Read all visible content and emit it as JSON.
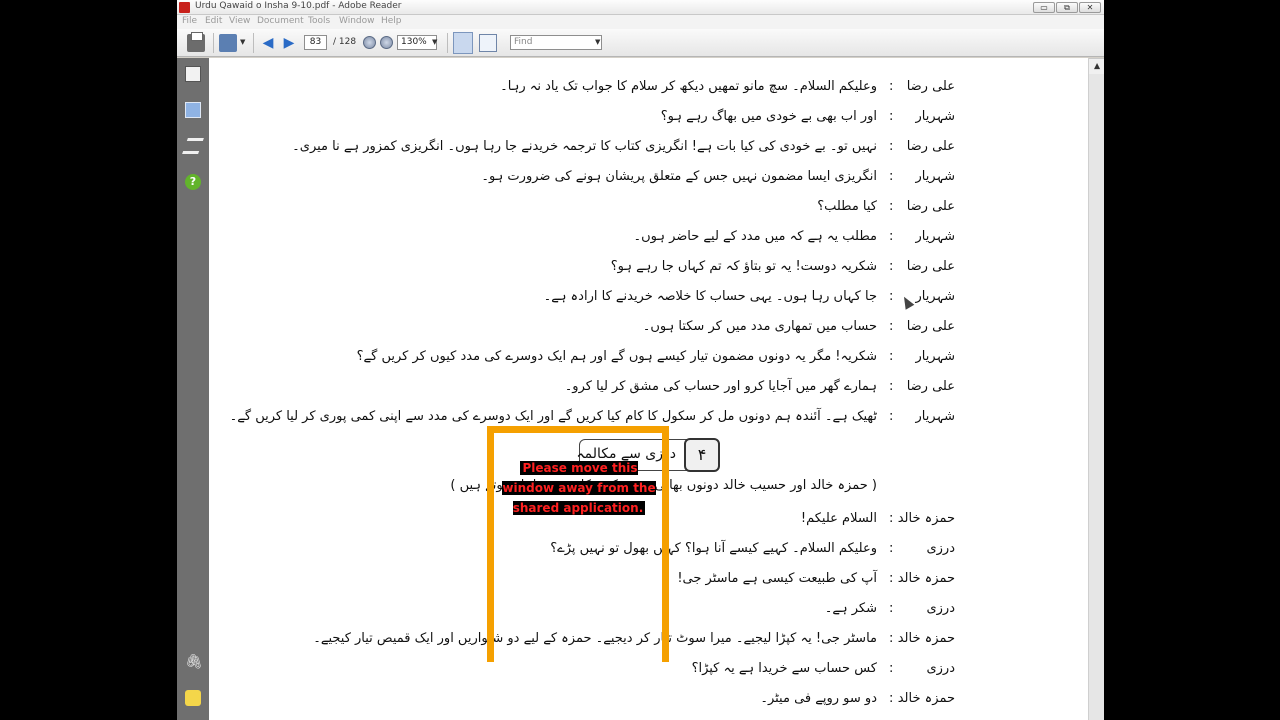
{
  "window": {
    "title": "Urdu Qawaid o Insha 9-10.pdf - Adobe Reader",
    "minimize": "▭",
    "restore": "⧉",
    "close": "✕"
  },
  "menu": [
    "File",
    "Edit",
    "View",
    "Document",
    "Tools",
    "Window",
    "Help"
  ],
  "toolbar": {
    "page_current": "83",
    "page_total": "/ 128",
    "zoom": "130%",
    "find_placeholder": "Find",
    "prev_icon": "◀",
    "next_icon": "▶",
    "dropdown_icon": "▼"
  },
  "navpane": {
    "help_icon": "?",
    "clip_icon": "🖇"
  },
  "dialogue1": [
    {
      "speaker": "علی رضا",
      "text": "وعلیکم السلام۔ سچ مانو تمھیں دیکھ کر سلام کا جواب تک یاد نہ رہا۔"
    },
    {
      "speaker": "شہریار",
      "text": "اور اب بھی بے خودی میں بھاگ رہے ہو؟"
    },
    {
      "speaker": "علی رضا",
      "text": "نہیں تو۔ بے خودی کی کیا بات ہے! انگریزی کتاب کا ترجمہ خریدنے جا رہا ہوں۔ انگریزی کمزور ہے نا میری۔"
    },
    {
      "speaker": "شہریار",
      "text": "انگریزی ایسا مضمون نہیں جس کے متعلق پریشان ہونے کی ضرورت ہو۔"
    },
    {
      "speaker": "علی رضا",
      "text": "کیا مطلب؟"
    },
    {
      "speaker": "شہریار",
      "text": "مطلب یہ ہے کہ میں مدد کے لیے حاضر ہوں۔"
    },
    {
      "speaker": "علی رضا",
      "text": "شکریہ دوست! یہ تو بتاؤ کہ تم کہاں جا رہے ہو؟"
    },
    {
      "speaker": "شہریار",
      "text": "جا کہاں رہا ہوں۔ یہی حساب کا خلاصہ خریدنے کا ارادہ ہے۔"
    },
    {
      "speaker": "علی رضا",
      "text": "حساب میں تمھاری مدد میں کر سکتا ہوں۔"
    },
    {
      "speaker": "شہریار",
      "text": "شکریہ! مگر یہ دونوں مضمون تیار کیسے ہوں گے اور ہم ایک دوسرے کی مدد کیوں کر کریں گے؟"
    },
    {
      "speaker": "علی رضا",
      "text": "ہمارے گھر میں آجایا کرو اور حساب کی مشق کر لیا کرو۔"
    },
    {
      "speaker": "شہریار",
      "text": "ٹھیک ہے۔ آئندہ ہم دونوں مل کر سکول کا کام کیا کریں گے اور ایک دوسرے کی مدد سے اپنی کمی پوری کر لیا کریں گے۔"
    }
  ],
  "lesson": {
    "number": "۴",
    "title": "درزی سے مکالمہ"
  },
  "scene_text": "( حمزہ خالد اور حسیب خالد دونوں بھائی درزی کی دکان میں داخل ہوتے ہیں )",
  "dialogue2": [
    {
      "speaker": "حمزہ خالد",
      "text": "السلام علیکم!"
    },
    {
      "speaker": "درزی",
      "text": "وعلیکم السلام۔ کہیے کیسے آنا ہوا؟ کہیں بھول تو نہیں پڑے؟"
    },
    {
      "speaker": "حمزہ خالد",
      "text": "آپ کی طبیعت کیسی ہے ماسٹر جی!"
    },
    {
      "speaker": "درزی",
      "text": "شکر ہے۔"
    },
    {
      "speaker": "حمزہ خالد",
      "text": "ماسٹر جی! یہ کپڑا لیجیے۔ میرا سوٹ تیار کر دیجیے۔ حمزہ کے لیے دو شلواریں اور ایک قمیص تیار کیجیے۔"
    },
    {
      "speaker": "درزی",
      "text": "کس حساب سے خریدا ہے یہ کپڑا؟"
    },
    {
      "speaker": "حمزہ خالد",
      "text": "دو سو روپے فی میٹر۔"
    }
  ],
  "colon": ":",
  "share_notice": "Please move this window away from the shared application."
}
